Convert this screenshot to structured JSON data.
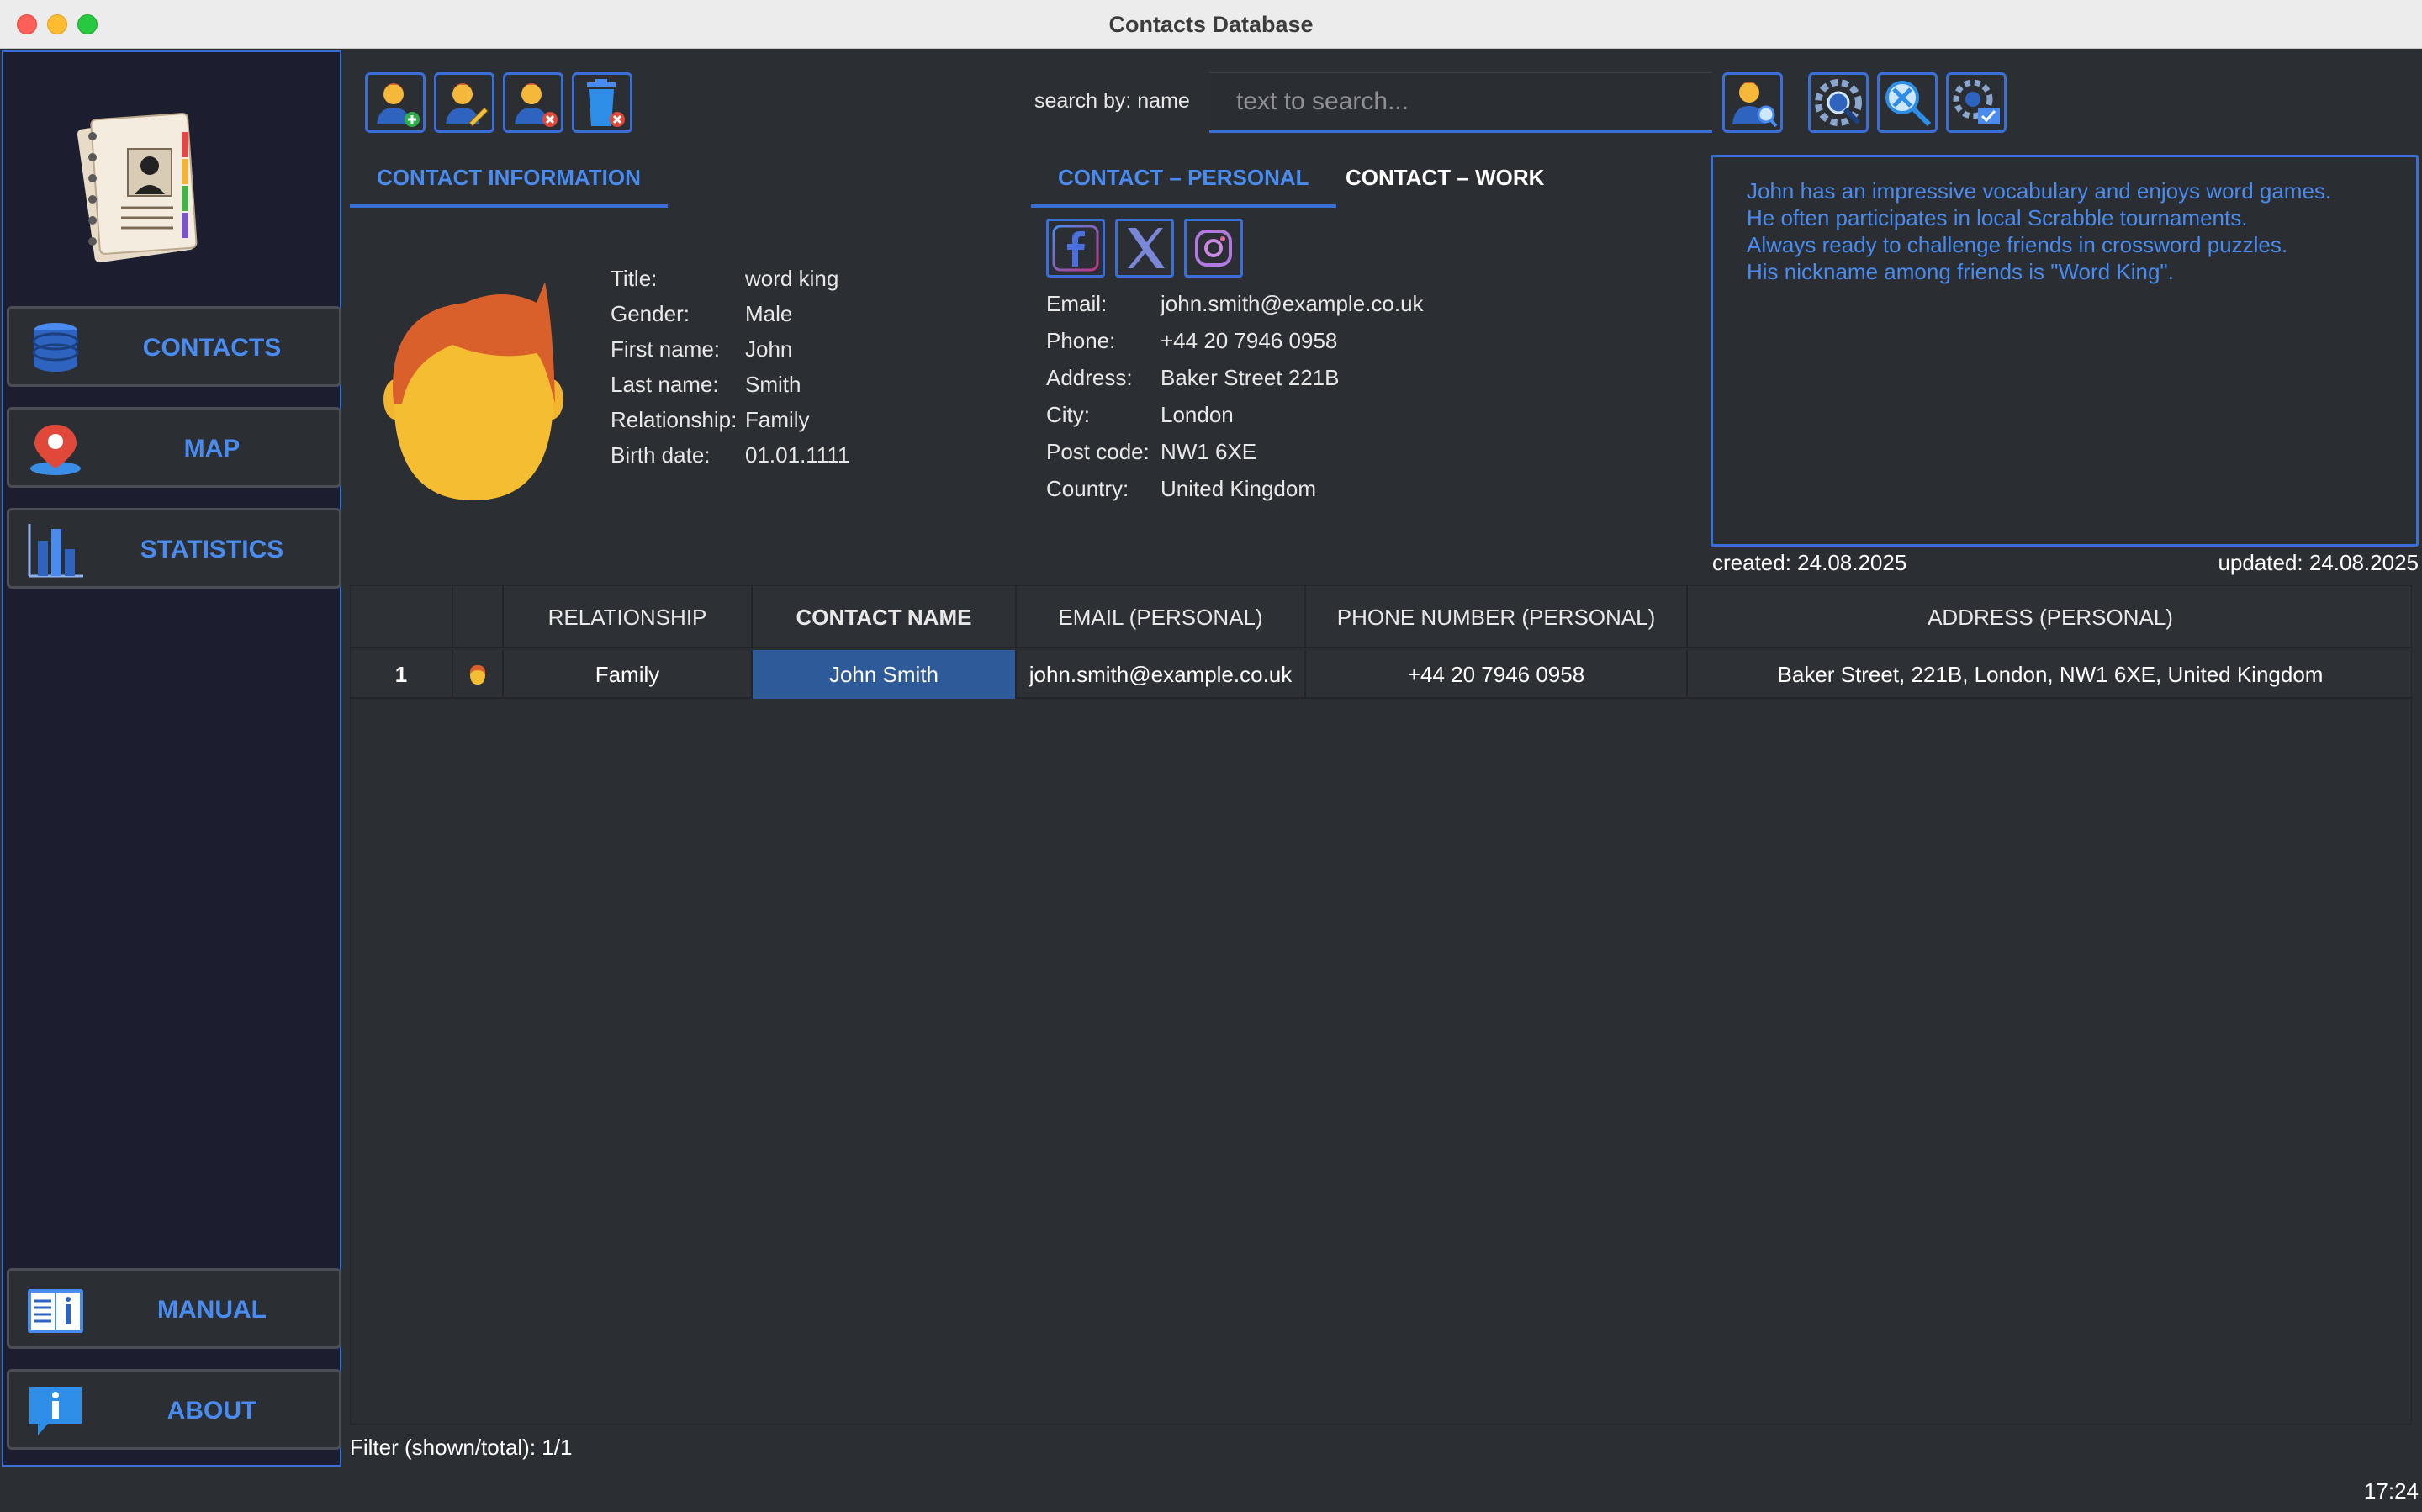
{
  "window": {
    "title": "Contacts Database"
  },
  "sidebar": {
    "items": [
      {
        "label": "CONTACTS",
        "icon": "database-icon"
      },
      {
        "label": "MAP",
        "icon": "map-pin-icon"
      },
      {
        "label": "STATISTICS",
        "icon": "bar-chart-icon"
      },
      {
        "label": "MANUAL",
        "icon": "manual-book-icon"
      },
      {
        "label": "ABOUT",
        "icon": "info-icon"
      }
    ]
  },
  "toolbar": {
    "buttons": [
      "add-contact-icon",
      "edit-contact-icon",
      "remove-contact-icon",
      "delete-trash-icon"
    ],
    "search_label": "search by: name",
    "search_placeholder": "text to search...",
    "search_value": ""
  },
  "tabs": {
    "info": "CONTACT INFORMATION",
    "personal": "CONTACT – PERSONAL",
    "work": "CONTACT – WORK"
  },
  "contact_info": {
    "labels": [
      "Title:",
      "Gender:",
      "First name:",
      "Last name:",
      "Relationship:",
      "Birth date:"
    ],
    "values": [
      "word king",
      "Male",
      "John",
      "Smith",
      "Family",
      "01.01.1111"
    ]
  },
  "personal": {
    "labels": [
      "Email:",
      "Phone:",
      "Address:",
      "City:",
      "Post code:",
      "Country:"
    ],
    "values": [
      "john.smith@example.co.uk",
      "+44 20 7946 0958",
      "Baker Street 221B",
      "London",
      "NW1 6XE",
      "United Kingdom"
    ]
  },
  "notes": [
    "John has an impressive vocabulary and enjoys word games.",
    "He often participates in local Scrabble tournaments.",
    "Always ready to challenge friends in crossword puzzles.",
    "His nickname among friends is \"Word King\"."
  ],
  "dates": {
    "created": "created: 24.08.2025",
    "updated": "updated: 24.08.2025"
  },
  "table": {
    "headers": [
      "",
      "",
      "RELATIONSHIP",
      "CONTACT NAME",
      "EMAIL (PERSONAL)",
      "PHONE NUMBER (PERSONAL)",
      "ADDRESS (PERSONAL)"
    ],
    "rows": [
      {
        "num": "1",
        "relationship": "Family",
        "name": "John Smith",
        "email": "john.smith@example.co.uk",
        "phone": "+44 20 7946 0958",
        "address": "Baker Street, 221B, London, NW1 6XE, United Kingdom"
      }
    ]
  },
  "footer": {
    "filter": "Filter (shown/total): 1/1",
    "clock": "17:24"
  },
  "colors": {
    "accent": "#3a6fd8",
    "accent_text": "#4a8bef",
    "sidebar_bg": "#1c1d2e",
    "panel_bg": "#2b2e33"
  }
}
